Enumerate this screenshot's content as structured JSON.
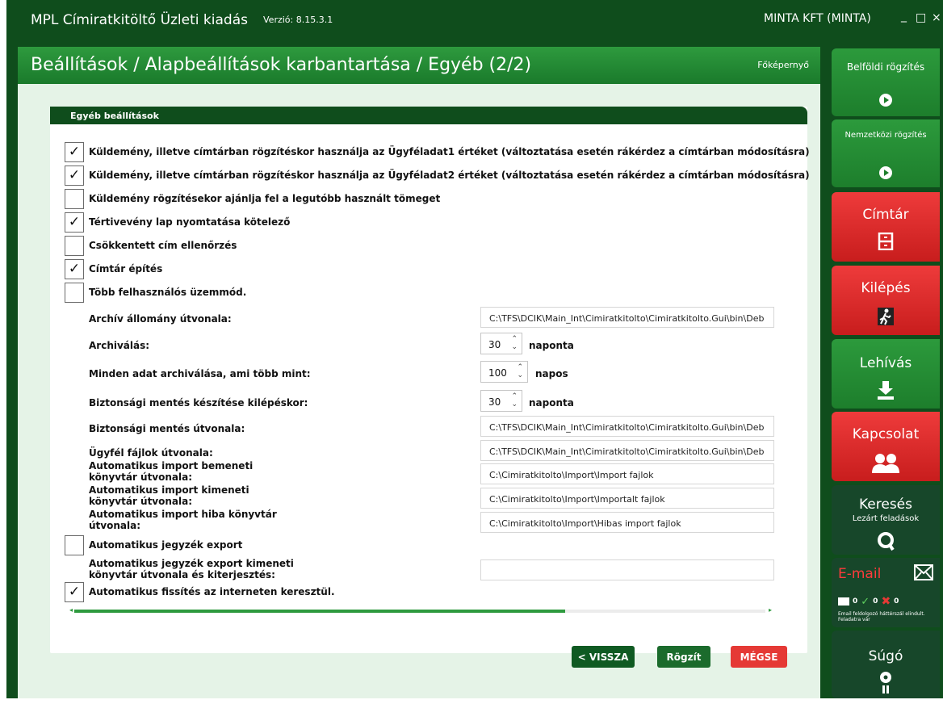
{
  "window": {
    "title": "MPL Címiratkitöltő Üzleti kiadás",
    "version": "Verzió: 8.15.3.1",
    "user": "MINTA KFT (MINTA)",
    "minimize": "_",
    "maximize": "□",
    "close": "×"
  },
  "header": {
    "breadcrumb": "Beállítások / Alapbeállítások karbantartása / Egyéb (2/2)",
    "home_link": "Főképernyő"
  },
  "panel": {
    "title": "Egyéb beállítások",
    "checkboxes": [
      {
        "label": "Küldemény, illetve címtárban rögzítéskor használja az Ügyféladat1 értéket (változtatása esetén rákérdez a címtárban módosításra)",
        "checked": true,
        "mark": "✓"
      },
      {
        "label": "Küldemény, illetve címtárban rögzítéskor használja az Ügyféladat2 értéket (változtatása esetén rákérdez a címtárban módosításra)",
        "checked": true,
        "mark": "✓"
      },
      {
        "label": "Küldemény rögzítésekor ajánlja fel a legutóbb használt tömeget",
        "checked": false,
        "mark": ""
      },
      {
        "label": "Tértivevény lap nyomtatása kötelező",
        "checked": true,
        "mark": "✓"
      },
      {
        "label": "Csökkentett cím ellenőrzés",
        "checked": false,
        "mark": ""
      },
      {
        "label": "Címtár építés",
        "checked": true,
        "mark": "✓"
      },
      {
        "label": "Több felhasználós üzemmód.",
        "checked": false,
        "mark": ""
      }
    ],
    "fields": {
      "archive_path": {
        "label": "Archív állomány útvonala:",
        "value": "C:\\TFS\\DCIK\\Main_Int\\Cimiratkitolto\\Cimiratkitolto.Gui\\bin\\Deb"
      },
      "archiving": {
        "label": "Archiválás:",
        "value": "30",
        "unit": "naponta"
      },
      "archive_all": {
        "label": "Minden adat archiválása, ami több mint:",
        "value": "100",
        "unit": "napos"
      },
      "backup_on_exit": {
        "label": "Biztonsági mentés készítése kilépéskor:",
        "value": "30",
        "unit": "naponta"
      },
      "backup_path": {
        "label": "Biztonsági mentés útvonala:",
        "value": "C:\\TFS\\DCIK\\Main_Int\\Cimiratkitolto\\Cimiratkitolto.Gui\\bin\\Deb"
      },
      "client_files_path": {
        "label": "Ügyfél fájlok útvonala:",
        "value": "C:\\TFS\\DCIK\\Main_Int\\Cimiratkitolto\\Cimiratkitolto.Gui\\bin\\Deb"
      },
      "import_input": {
        "label": "Automatikus import bemeneti könyvtár útvonala:",
        "value": "C:\\Cimiratkitolto\\Import\\Import fajlok"
      },
      "import_output": {
        "label": "Automatikus import kimeneti könyvtár útvonala:",
        "value": "C:\\Cimiratkitolto\\Import\\Importalt fajlok"
      },
      "import_error": {
        "label": "Automatikus import hiba könyvtár útvonala:",
        "value": "C:\\Cimiratkitolto\\Import\\Hibas import fajlok"
      },
      "register_export_path": {
        "label": "Automatikus jegyzék export kimeneti könyvtár útvonala és kiterjesztés:",
        "value": ""
      }
    },
    "register_export": {
      "label": "Automatikus jegyzék export",
      "checked": false,
      "mark": ""
    },
    "auto_update": {
      "label": "Automatikus fissítés az interneten keresztül.",
      "checked": true,
      "mark": "✓"
    },
    "scroll_fraction": 0.71
  },
  "buttons": {
    "back": "< VISSZA",
    "save": "Rögzít",
    "cancel": "MÉGSE"
  },
  "sidebar": {
    "domestic": {
      "label": "Belföldi rögzítés",
      "icon": "play-icon"
    },
    "international": {
      "label": "Nemzetközi rögzítés",
      "icon": "play-icon"
    },
    "address_book": {
      "label": "Címtár",
      "icon": "cabinet-icon"
    },
    "exit": {
      "label": "Kilépés",
      "icon": "exit-running-man-icon"
    },
    "download": {
      "label": "Lehívás",
      "icon": "download-icon"
    },
    "contact": {
      "label": "Kapcsolat",
      "icon": "people-icon"
    },
    "search": {
      "label": "Keresés",
      "sublabel": "Lezárt feladások",
      "icon": "search-icon"
    },
    "email": {
      "label": "E-mail",
      "count_mail": "0",
      "count_ok": "0",
      "count_err": "0",
      "status": "Email feldolgozó háttérszál elindult. Feladatra vár",
      "icon": "envelope-icon"
    },
    "help": {
      "label": "Súgó",
      "icon": "info-icon"
    }
  },
  "colors": {
    "dark_green": "#0f4d1c",
    "green": "#2e9a3e",
    "red": "#e53935",
    "background": "#e5f3e7"
  }
}
